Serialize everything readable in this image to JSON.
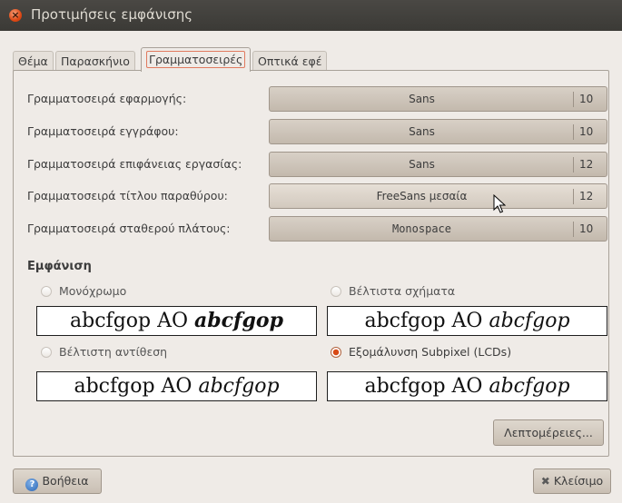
{
  "window": {
    "title": "Προτιμήσεις εμφάνισης"
  },
  "tabs": [
    {
      "label": "Θέμα"
    },
    {
      "label": "Παρασκήνιο"
    },
    {
      "label": "Γραμματοσειρές"
    },
    {
      "label": "Οπτικά εφέ"
    }
  ],
  "fonts": [
    {
      "label": "Γραμματοσειρά εφαρμογής:",
      "name": "Sans",
      "size": "10"
    },
    {
      "label": "Γραμματοσειρά εγγράφου:",
      "name": "Sans",
      "size": "10"
    },
    {
      "label": "Γραμματοσειρά επιφάνειας εργασίας:",
      "name": "Sans",
      "size": "12"
    },
    {
      "label": "Γραμματοσειρά τίτλου παραθύρου:",
      "name": "FreeSans μεσαία",
      "size": "12"
    },
    {
      "label": "Γραμματοσειρά σταθερού πλάτους:",
      "name": "Monospace",
      "size": "10"
    }
  ],
  "rendering": {
    "title": "Εμφάνιση",
    "options": [
      {
        "label": "Μονόχρωμο",
        "selected": false
      },
      {
        "label": "Βέλτιστα σχήματα",
        "selected": false
      },
      {
        "label": "Βέλτιστη αντίθεση",
        "selected": false
      },
      {
        "label": "Εξομάλυνση Subpixel (LCDs)",
        "selected": true
      }
    ],
    "sample_plain": "abcfgop AO ",
    "sample_emph": "abcfgop"
  },
  "buttons": {
    "details": "Λεπτομέρειες...",
    "help": "Βοήθεια",
    "close": "Κλείσιμο"
  },
  "colors": {
    "titlebar": "#3c3b37",
    "accent": "#dd4814"
  }
}
